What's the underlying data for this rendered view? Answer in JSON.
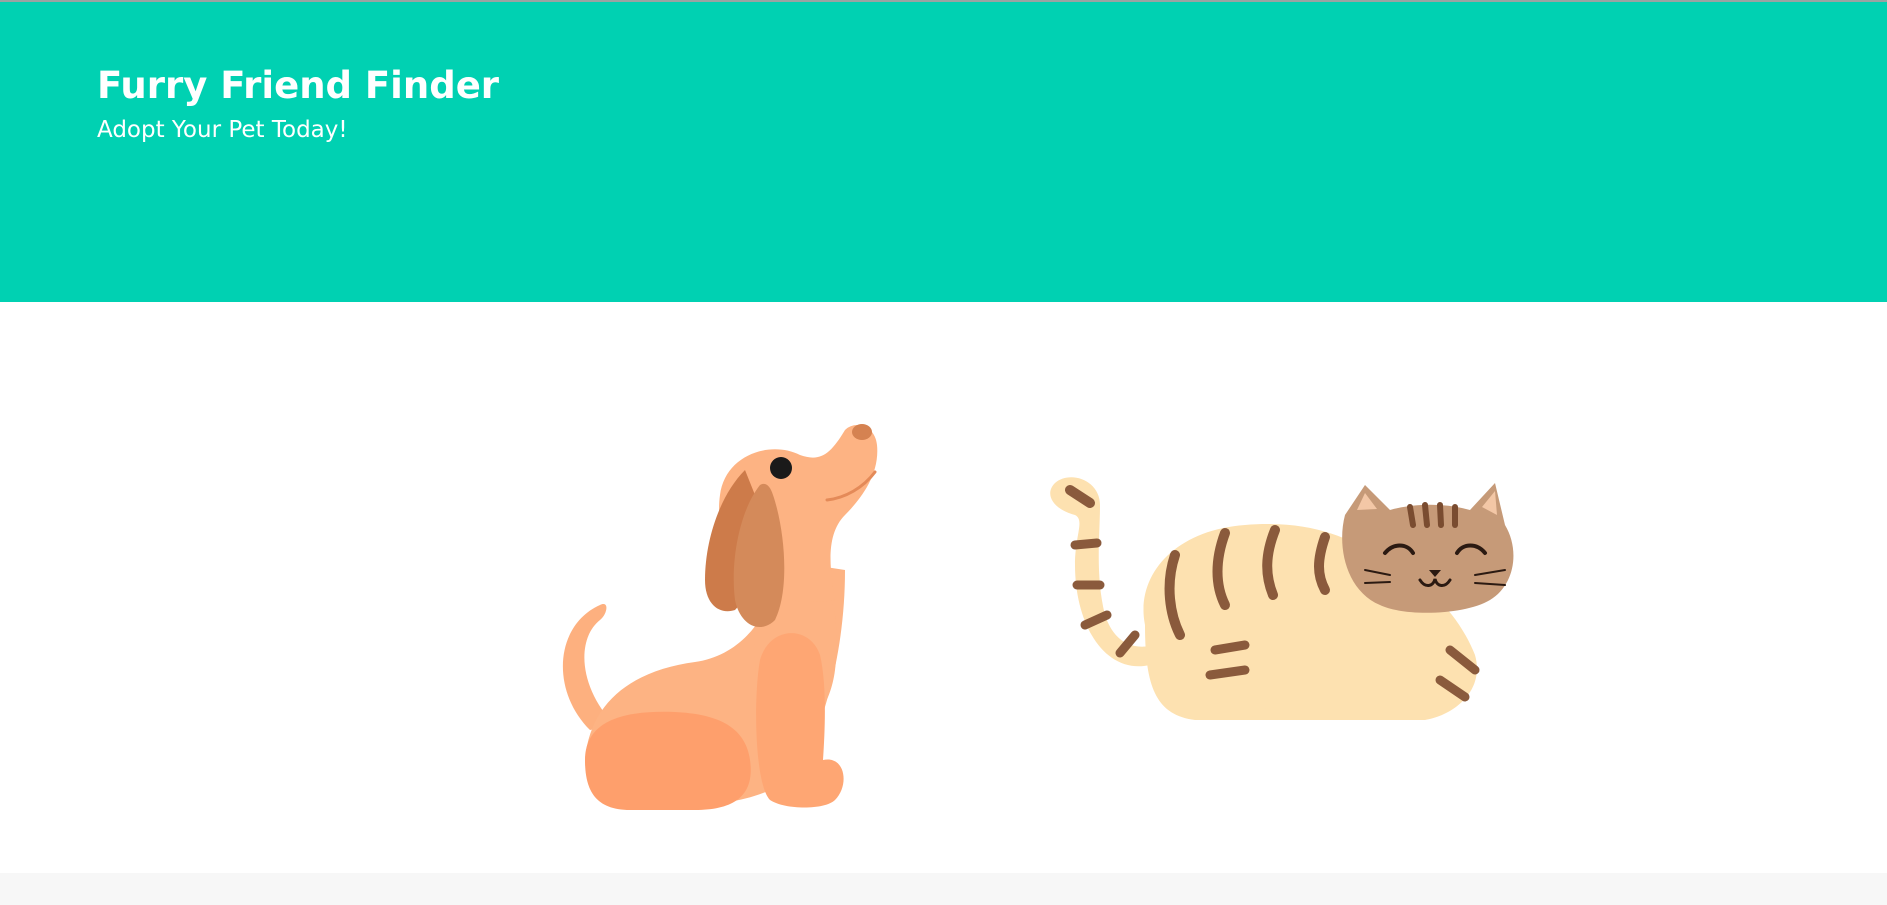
{
  "hero": {
    "title": "Furry Friend Finder",
    "subtitle": "Adopt Your Pet Today!",
    "background_color": "#00d1b2",
    "text_color": "#ffffff"
  },
  "pets": [
    {
      "name": "dog-illustration",
      "kind": "dog"
    },
    {
      "name": "cat-illustration",
      "kind": "cat"
    }
  ],
  "footer": {
    "background_color": "#f7f7f7"
  }
}
